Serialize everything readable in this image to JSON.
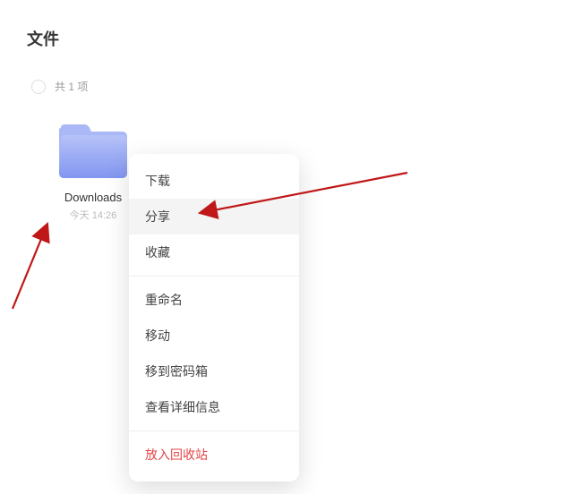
{
  "title": "文件",
  "item_count_text": "共 1 项",
  "folder": {
    "name": "Downloads",
    "time": "今天 14:26"
  },
  "menu": {
    "download": "下载",
    "share": "分享",
    "favorite": "收藏",
    "rename": "重命名",
    "move": "移动",
    "move_to_vault": "移到密码箱",
    "view_details": "查看详细信息",
    "recycle": "放入回收站"
  },
  "colors": {
    "danger": "#e64545",
    "folder_light": "#aab8f5",
    "folder_dark": "#8296f0",
    "arrow": "#c01818"
  }
}
